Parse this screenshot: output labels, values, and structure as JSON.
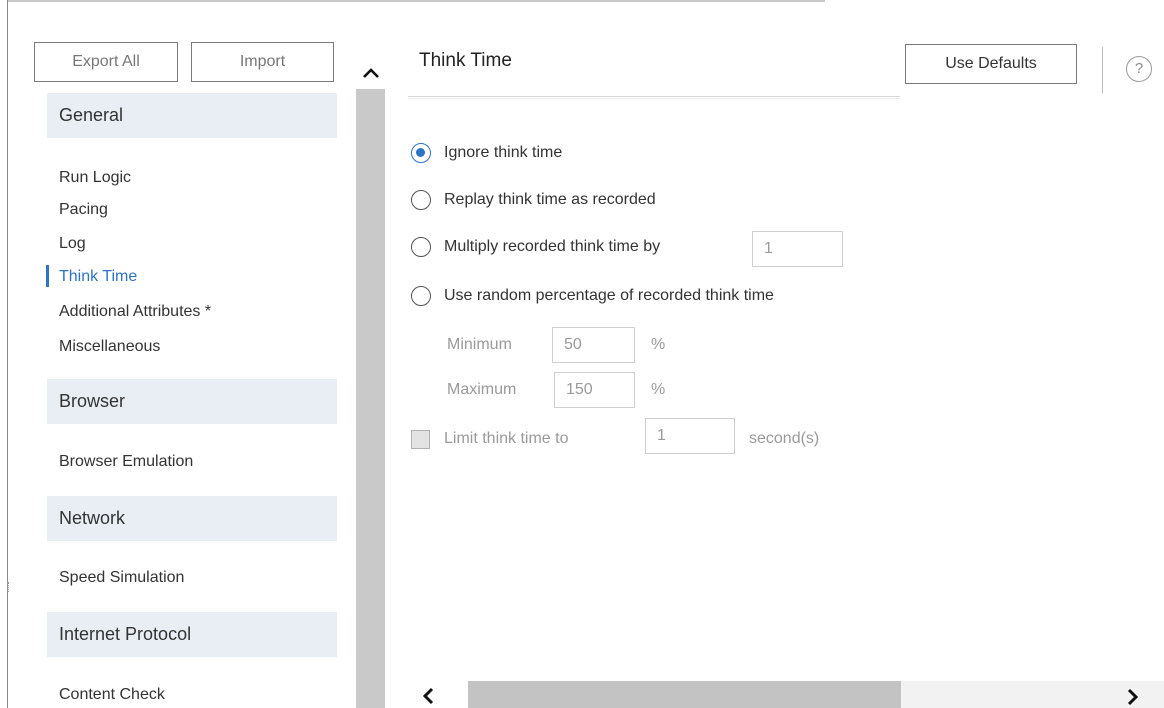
{
  "toolbar": {
    "export_all_label": "Export All",
    "import_label": "Import"
  },
  "sidebar": {
    "sections": [
      {
        "header": "General",
        "items": [
          "Run Logic",
          "Pacing",
          "Log",
          "Think Time",
          "Additional Attributes *",
          "Miscellaneous"
        ]
      },
      {
        "header": "Browser",
        "items": [
          "Browser Emulation"
        ]
      },
      {
        "header": "Network",
        "items": [
          "Speed Simulation"
        ]
      },
      {
        "header": "Internet Protocol",
        "items": [
          "Content Check"
        ]
      }
    ],
    "active_item": "Think Time"
  },
  "panel": {
    "title": "Think Time",
    "use_defaults_label": "Use Defaults",
    "help_icon": "?",
    "options": [
      {
        "label": "Ignore think time",
        "checked": true
      },
      {
        "label": "Replay think time as recorded",
        "checked": false
      },
      {
        "label": "Multiply recorded think time by",
        "checked": false,
        "value": "1"
      },
      {
        "label": "Use random percentage of recorded think time",
        "checked": false
      }
    ],
    "minimum": {
      "label": "Minimum",
      "value": "50",
      "unit": "%"
    },
    "maximum": {
      "label": "Maximum",
      "value": "150",
      "unit": "%"
    },
    "limit": {
      "label": "Limit think time to",
      "value": "1",
      "unit": "second(s)",
      "checked": false
    }
  },
  "colors": {
    "accent": "#2f73c5",
    "section_bg": "#e9eef5",
    "scrollbar": "#c9c9c9"
  },
  "icons": {
    "scroll_up": "chevron-up-icon",
    "scroll_left": "chevron-left-icon",
    "scroll_right": "chevron-right-icon",
    "help": "help-icon"
  }
}
